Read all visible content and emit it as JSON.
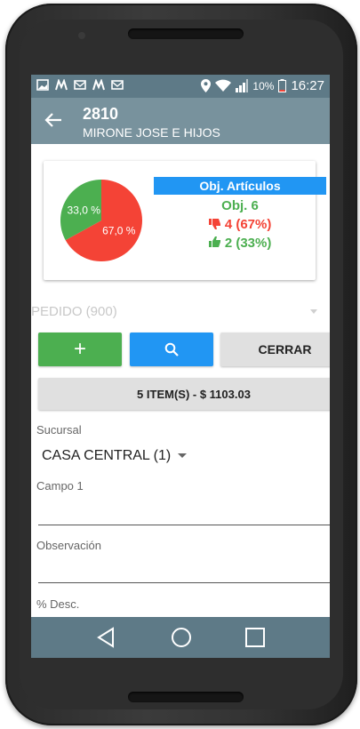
{
  "statusbar": {
    "battery": "10%",
    "time": "16:27",
    "icons": [
      "image-icon",
      "m-icon",
      "mail-icon",
      "m-icon",
      "mail-icon",
      "location-icon",
      "wifi-icon",
      "signal-icon",
      "battery-icon"
    ]
  },
  "appbar": {
    "title": "2810",
    "subtitle": "MIRONE JOSE E HIJOS"
  },
  "objective": {
    "pie": [
      {
        "label": "67,0 %",
        "value": 67.0,
        "color": "#f44336"
      },
      {
        "label": "33,0 %",
        "value": 33.0,
        "color": "#4caf50"
      }
    ],
    "header": "Obj. Artículos",
    "target": "Obj. 6",
    "negative": "4 (67%)",
    "positive": "2 (33%)"
  },
  "pedido": {
    "selected": "PEDIDO (900)"
  },
  "buttons": {
    "add": "+",
    "close": "CERRAR"
  },
  "summary": "5 ITEM(S) - $ 1103.03",
  "form": {
    "sucursal_label": "Sucursal",
    "sucursal_value": "CASA CENTRAL (1)",
    "campo1_label": "Campo 1",
    "campo1_value": "",
    "observacion_label": "Observación",
    "observacion_value": "",
    "desc_label": "% Desc."
  },
  "colors": {
    "appbar": "#78929d",
    "statusbar": "#5e7a87",
    "green": "#4caf50",
    "blue": "#2196f3",
    "red": "#f44336"
  }
}
